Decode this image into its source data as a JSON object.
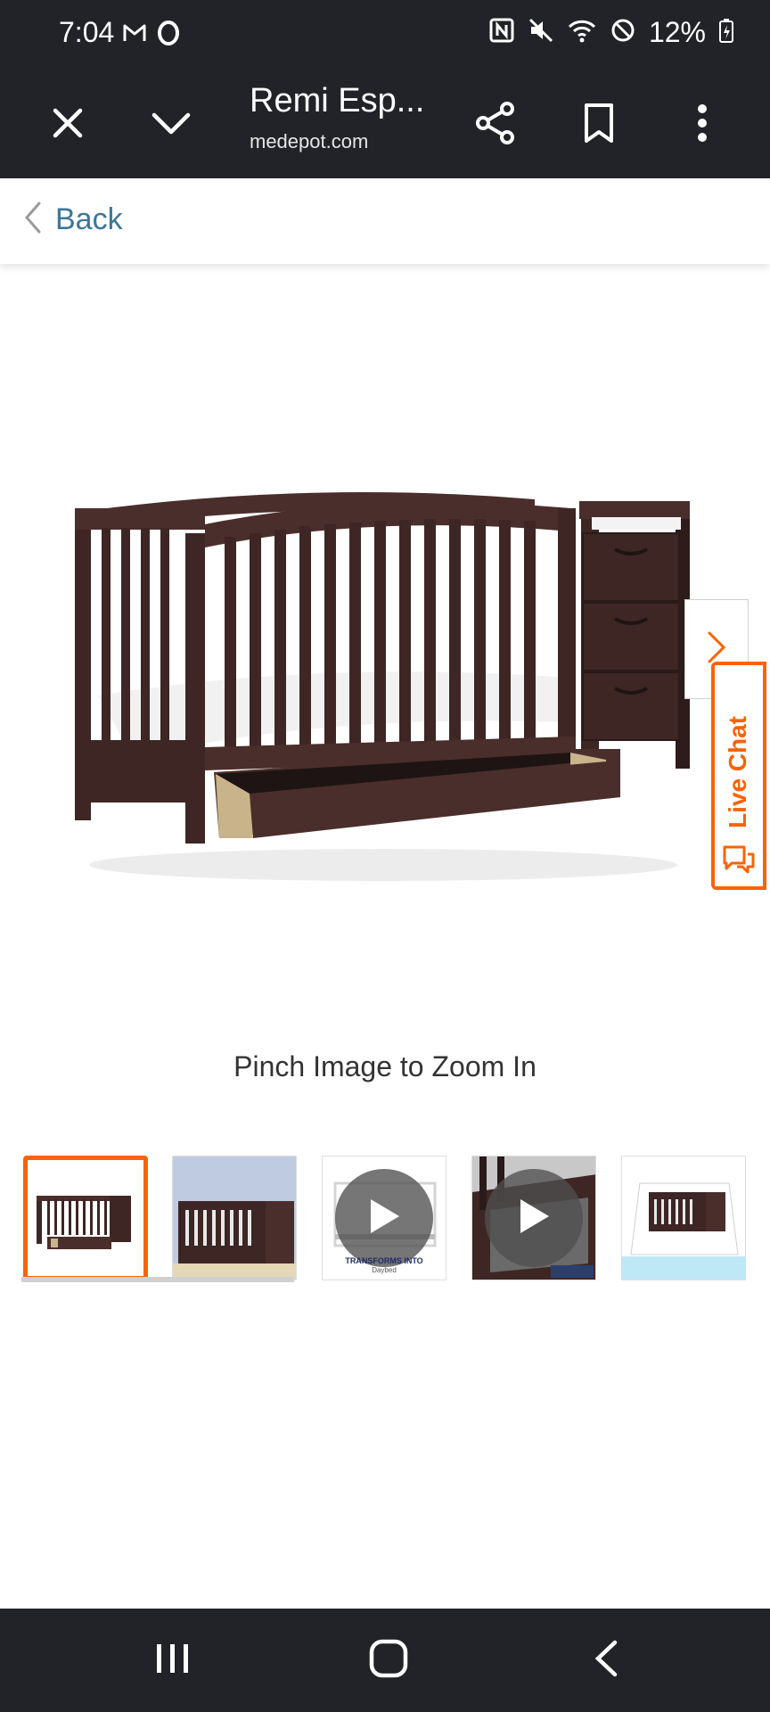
{
  "status_bar": {
    "time": "7:04",
    "battery_percent": "12%",
    "icons": [
      "gmail-icon",
      "opera-icon",
      "nfc-icon",
      "mute-icon",
      "wifi-icon",
      "do-not-disturb-icon",
      "battery-charging-icon"
    ]
  },
  "browser_toolbar": {
    "title": "Remi Esp...",
    "url": "medepot.com",
    "icons": [
      "close-icon",
      "chevron-down-icon",
      "share-icon",
      "bookmark-icon",
      "more-vert-icon"
    ]
  },
  "back_bar": {
    "label": "Back"
  },
  "main": {
    "zoom_hint": "Pinch Image to Zoom In",
    "live_chat_label": "Live Chat"
  },
  "thumbnails": [
    {
      "kind": "image",
      "selected": true
    },
    {
      "kind": "image",
      "selected": false
    },
    {
      "kind": "video",
      "selected": false,
      "caption": "TRANSFORMS INTO",
      "subcaption": "Daybed"
    },
    {
      "kind": "video",
      "selected": false
    },
    {
      "kind": "image",
      "selected": false
    }
  ],
  "colors": {
    "accent": "#f96302",
    "bar_background": "#212328",
    "link": "#3e7697",
    "wood": "#3d2624"
  },
  "nav_bar": {
    "icons": [
      "recent-apps-icon",
      "home-icon",
      "back-icon"
    ]
  }
}
